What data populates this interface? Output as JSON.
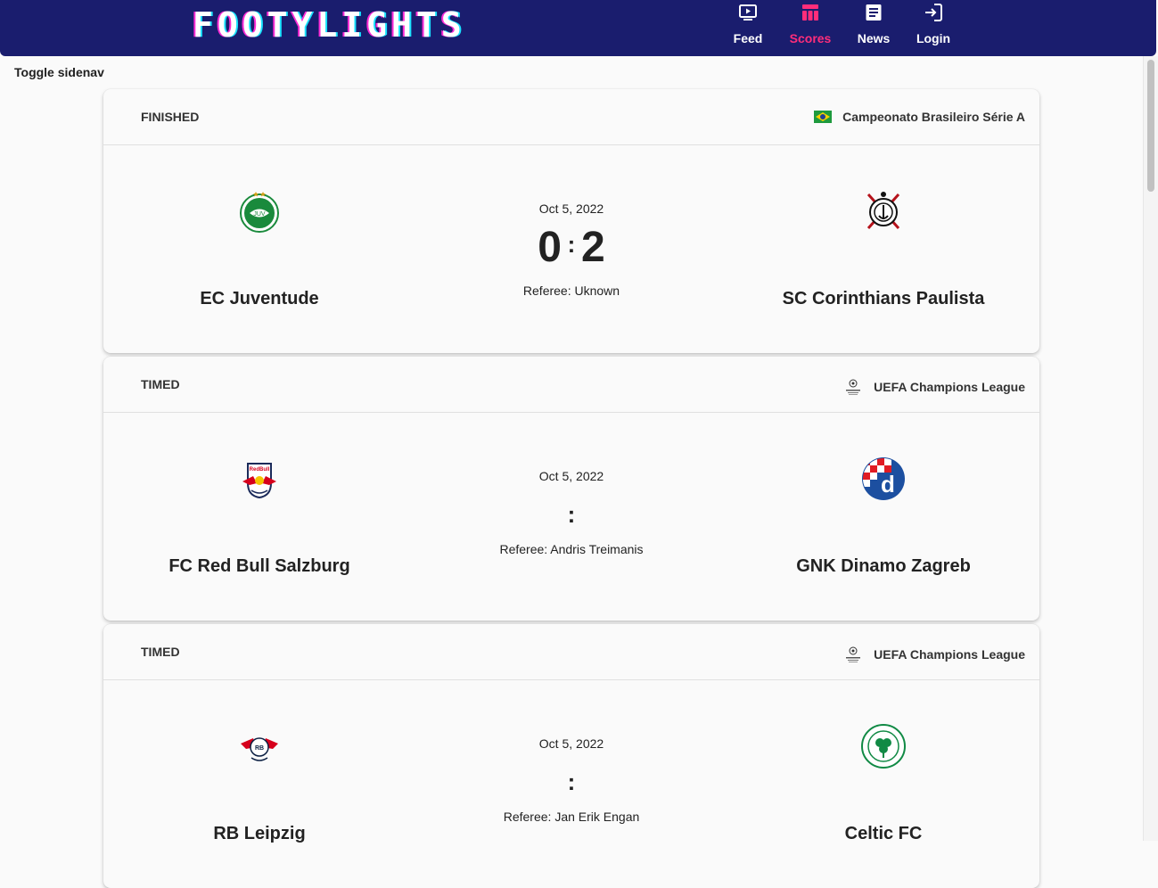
{
  "app": {
    "logo": "FOOTYLIGHTS"
  },
  "nav": [
    {
      "label": "Feed",
      "icon": "feed-icon",
      "active": false
    },
    {
      "label": "Scores",
      "icon": "scores-icon",
      "active": true
    },
    {
      "label": "News",
      "icon": "news-icon",
      "active": false
    },
    {
      "label": "Login",
      "icon": "login-icon",
      "active": false
    }
  ],
  "colors": {
    "header": "#1a1d6e",
    "accent": "#ff2d7a",
    "background": "#fafafa"
  },
  "sidenav": {
    "toggle_label": "Toggle sidenav"
  },
  "matches": [
    {
      "status": "FINISHED",
      "league": "Campeonato Brasileiro Série A",
      "league_icon": "brazil-flag-icon",
      "date": "Oct 5, 2022",
      "score_home": "0",
      "score_away": "2",
      "referee": "Referee: Uknown",
      "home": {
        "name": "EC Juventude",
        "crest": "juventude-crest-icon"
      },
      "away": {
        "name": "SC Corinthians Paulista",
        "crest": "corinthians-crest-icon"
      }
    },
    {
      "status": "TIMED",
      "league": "UEFA Champions League",
      "league_icon": "champions-league-icon",
      "date": "Oct 5, 2022",
      "score_home": "",
      "score_away": "",
      "referee": "Referee: Andris Treimanis",
      "home": {
        "name": "FC Red Bull Salzburg",
        "crest": "salzburg-crest-icon"
      },
      "away": {
        "name": "GNK Dinamo Zagreb",
        "crest": "dinamo-zagreb-crest-icon"
      }
    },
    {
      "status": "TIMED",
      "league": "UEFA Champions League",
      "league_icon": "champions-league-icon",
      "date": "Oct 5, 2022",
      "score_home": "",
      "score_away": "",
      "referee": "Referee: Jan Erik Engan",
      "home": {
        "name": "RB Leipzig",
        "crest": "rb-leipzig-crest-icon"
      },
      "away": {
        "name": "Celtic FC",
        "crest": "celtic-crest-icon"
      }
    }
  ]
}
